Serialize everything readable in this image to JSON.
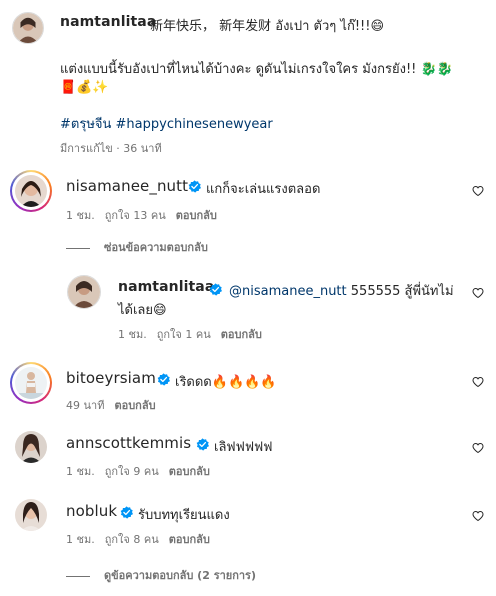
{
  "caption": {
    "username": "namtanlitaa",
    "line1": "新年快乐， 新年发财 อังเปา ตัวๆ ไก๊!!!😄",
    "line2": "แต่งแบบนี้รับอังเปาที่ไหนได้บ้างคะ ดูดันไม่เกรงใจใคร มังกรยัง!! 🐉🐉",
    "line3": "🧧💰✨",
    "hashtags": "#ตรุษจีน #happychinesenewyear",
    "meta": "มีการแก้ไข · 36 นาที"
  },
  "comments": [
    {
      "username": "nisamanee_nutt",
      "verified": true,
      "text": "แกก็จะเล่นแรงตลอด",
      "time": "1 ชม.",
      "likes": "ถูกใจ 13 คน",
      "reply_label": "ตอบกลับ"
    },
    {
      "username": "bitoeyrsiam",
      "verified": true,
      "text": "เริดดด🔥🔥🔥🔥",
      "time": "49 นาที",
      "likes": "",
      "reply_label": "ตอบกลับ"
    },
    {
      "username": "annscottkemmis",
      "verified": true,
      "text": "เลิฟฟฟฟฟ",
      "time": "1 ชม.",
      "likes": "ถูกใจ 9 คน",
      "reply_label": "ตอบกลับ"
    },
    {
      "username": "nobluk",
      "verified": true,
      "text": "รับบททุเรียนแดง",
      "time": "1 ชม.",
      "likes": "ถูกใจ 8 คน",
      "reply_label": "ตอบกลับ"
    }
  ],
  "hide_replies": "ซ่อนข้อความตอบกลับ",
  "reply": {
    "username": "namtanlitaa",
    "verified": true,
    "mention": "@nisamanee_nutt",
    "text_line1": " 555555 สู้พี่นัทไม่",
    "text_line2": "ได้เลย😄",
    "time": "1 ชม.",
    "likes": "ถูกใจ 1 คน",
    "reply_label": "ตอบกลับ"
  },
  "view_replies": "ดูข้อความตอบกลับ (2 รายการ)",
  "icons": {
    "verified": "verified-badge-icon",
    "like": "heart-outline-icon"
  },
  "colors": {
    "verified_blue": "#0095f6",
    "link_blue": "#00376b",
    "secondary_text": "#737373"
  }
}
